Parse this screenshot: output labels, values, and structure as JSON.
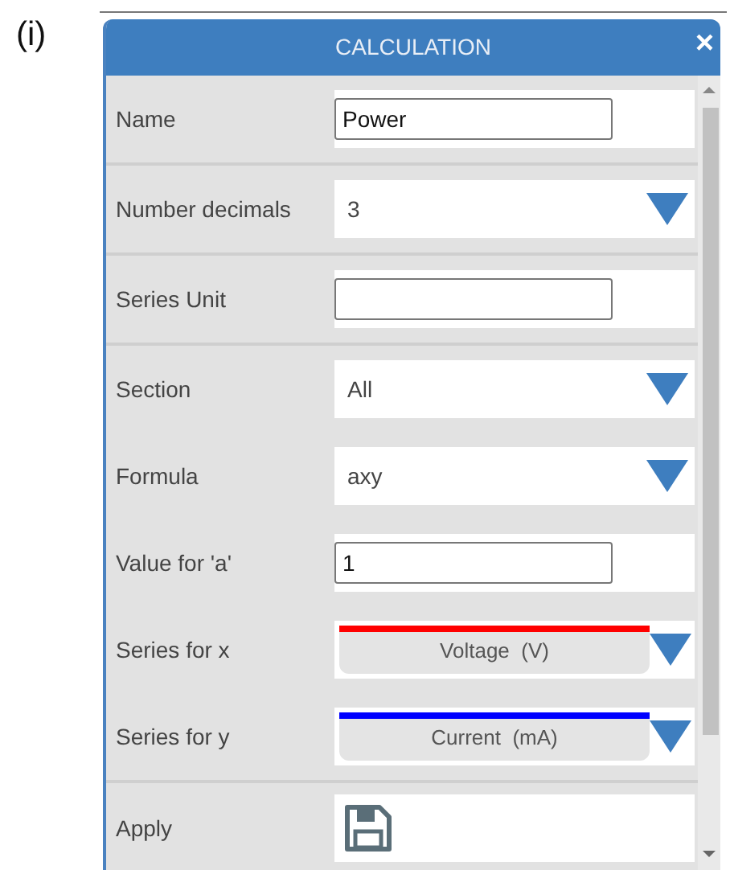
{
  "figure_label": "(i)",
  "dialog": {
    "title": "CALCULATION",
    "close": "×",
    "sections": [
      {
        "rows": [
          {
            "kind": "text",
            "label": "Name",
            "value": "Power"
          }
        ]
      },
      {
        "rows": [
          {
            "kind": "select",
            "label": "Number decimals",
            "value": "3"
          }
        ]
      },
      {
        "rows": [
          {
            "kind": "text",
            "label": "Series Unit"
          }
        ]
      },
      {
        "rows": [
          {
            "kind": "select",
            "label": "Section",
            "value": "All"
          },
          {
            "kind": "select",
            "label": "Formula",
            "value": "axy"
          },
          {
            "kind": "text",
            "label": "Value for 'a'",
            "value": "1"
          },
          {
            "kind": "series",
            "label": "Series for x",
            "value": "Voltage  (V)",
            "color": "#ff0000"
          },
          {
            "kind": "series",
            "label": "Series for y",
            "value": "Current  (mA)",
            "color": "#0000ff"
          }
        ]
      },
      {
        "rows": [
          {
            "kind": "apply",
            "label": "Apply"
          }
        ]
      }
    ]
  }
}
